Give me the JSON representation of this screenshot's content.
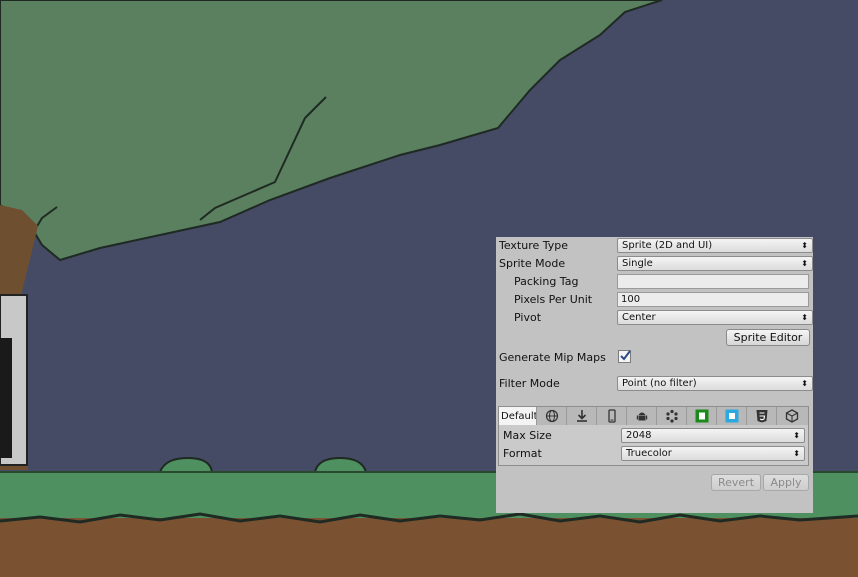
{
  "inspector": {
    "texture_type": {
      "label": "Texture Type",
      "value": "Sprite (2D and UI)"
    },
    "sprite_mode": {
      "label": "Sprite Mode",
      "value": "Single"
    },
    "packing_tag": {
      "label": "Packing Tag",
      "value": ""
    },
    "pixels_per_unit": {
      "label": "Pixels Per Unit",
      "value": "100"
    },
    "pivot": {
      "label": "Pivot",
      "value": "Center"
    },
    "sprite_editor_button": "Sprite Editor",
    "generate_mip_maps": {
      "label": "Generate Mip Maps",
      "checked": true
    },
    "filter_mode": {
      "label": "Filter Mode",
      "value": "Point (no filter)"
    },
    "platform_tabs": {
      "active_label": "Default",
      "icons": [
        "globe-icon",
        "download-icon",
        "phone-icon",
        "android-icon",
        "blackberry-icon",
        "xbox-icon",
        "windows-store-icon",
        "html5-icon",
        "unity-cube-icon"
      ]
    },
    "max_size": {
      "label": "Max Size",
      "value": "2048"
    },
    "format": {
      "label": "Format",
      "value": "Truecolor"
    },
    "revert_button": "Revert",
    "apply_button": "Apply"
  },
  "colors": {
    "sky": "#454a65",
    "tree": "#5a8060",
    "grass": "#4e9060",
    "dirt": "#7a5232",
    "panel": "#c2c2c2",
    "xbox_green": "#1a8a1a",
    "store_blue": "#2aa8e0"
  }
}
